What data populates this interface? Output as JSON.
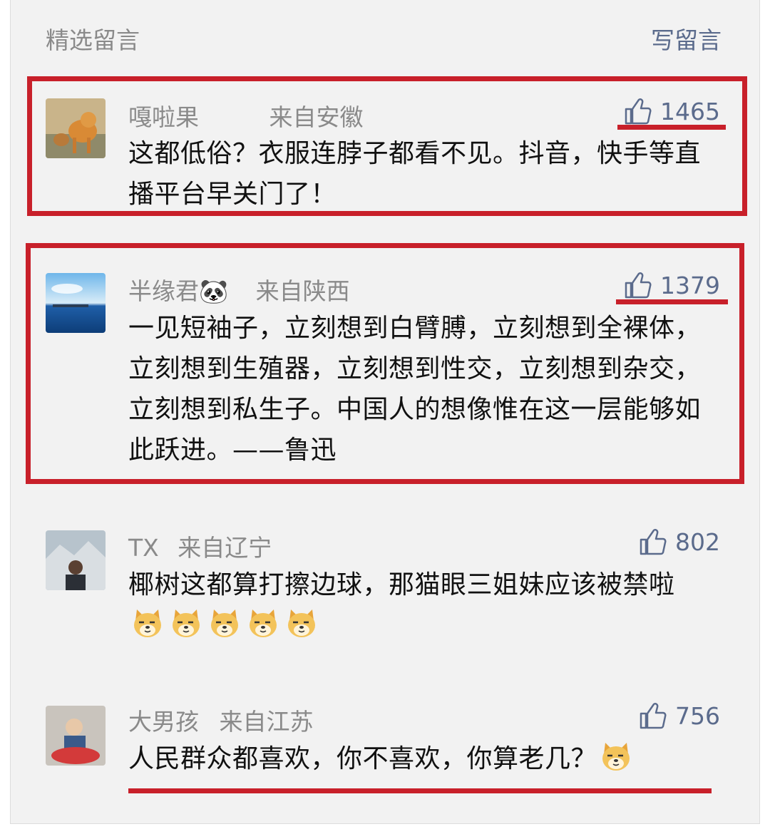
{
  "header": {
    "title": "精选留言",
    "write_label": "写留言"
  },
  "comments": [
    {
      "name": "嘎啦果",
      "location": "来自安徽",
      "likes": "1465",
      "text": "这都低俗？衣服连脖子都看不见。抖音，快手等直播平台早关门了！"
    },
    {
      "name": "半缘君🐼",
      "location": "来自陕西",
      "likes": "1379",
      "text": "一见短袖子，立刻想到白臂膊，立刻想到全裸体，立刻想到生殖器，立刻想到性交，立刻想到杂交，立刻想到私生子。中国人的想像惟在这一层能够如此跃进。——鲁迅"
    },
    {
      "name": "TX",
      "location": "来自辽宁",
      "likes": "802",
      "text": "椰树这都算打擦边球，那猫眼三姐妹应该被禁啦"
    },
    {
      "name": "大男孩",
      "location": "来自江苏",
      "likes": "756",
      "text": "人民群众都喜欢，你不喜欢，你算老几？"
    }
  ],
  "icons": {
    "like": "thumbs-up-icon",
    "emoji": "doge-emoji-icon"
  },
  "colors": {
    "highlight": "#c8202a",
    "link": "#5b6b8c",
    "muted": "#8a8a8a"
  }
}
